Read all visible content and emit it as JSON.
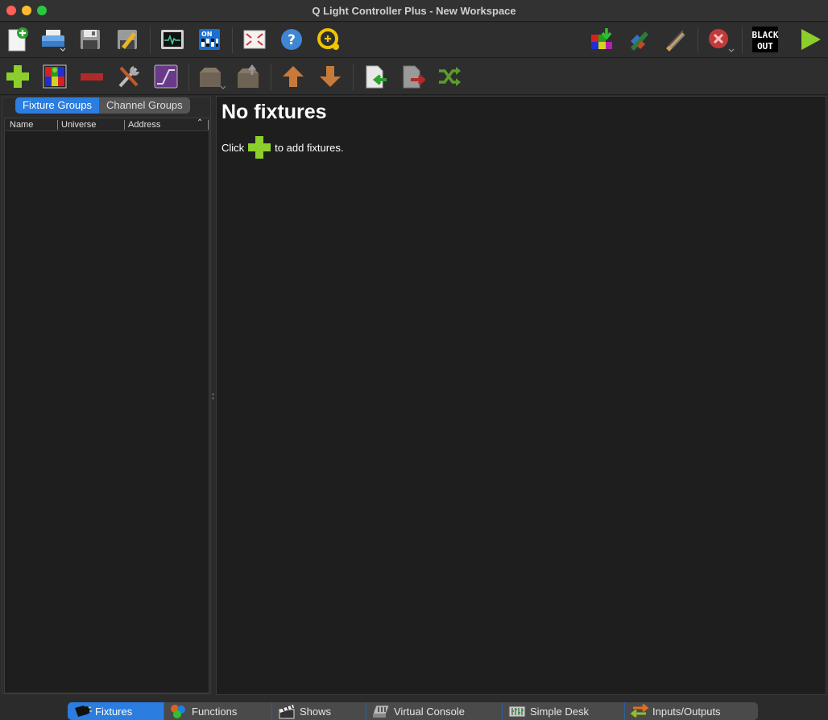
{
  "window": {
    "title": "Q Light Controller Plus - New Workspace"
  },
  "toolbar_main": {
    "items": [
      {
        "name": "new-workspace",
        "icon": "new-document-icon"
      },
      {
        "name": "open-workspace",
        "icon": "printer-open-icon"
      },
      {
        "name": "save-workspace",
        "icon": "floppy-disk-icon"
      },
      {
        "name": "save-as-workspace",
        "icon": "floppy-pencil-icon"
      },
      {
        "name": "monitor",
        "icon": "monitor-waveform-icon"
      },
      {
        "name": "address-tool",
        "icon": "dip-switch-icon",
        "label": "ON"
      },
      {
        "name": "fullscreen",
        "icon": "fullscreen-icon"
      },
      {
        "name": "help",
        "icon": "help-icon",
        "label": "?"
      },
      {
        "name": "about",
        "icon": "qlc-logo-icon"
      },
      {
        "name": "fixture-editor",
        "icon": "fixture-download-icon"
      },
      {
        "name": "design-mode",
        "icon": "design-pencil-icon"
      },
      {
        "name": "operate-mode",
        "icon": "operate-pencil-icon"
      },
      {
        "name": "stop-all",
        "icon": "stop-x-icon"
      },
      {
        "name": "blackout",
        "icon": "blackout-icon",
        "label_top": "BLACK",
        "label_bottom": "OUT"
      },
      {
        "name": "run-mode",
        "icon": "play-icon"
      }
    ]
  },
  "toolbar_fixtures": {
    "items": [
      {
        "name": "add-fixture",
        "icon": "plus-icon"
      },
      {
        "name": "add-rgb-panel",
        "icon": "rgb-panel-icon"
      },
      {
        "name": "remove-fixture",
        "icon": "minus-icon"
      },
      {
        "name": "fixture-properties",
        "icon": "wrench-screwdriver-icon"
      },
      {
        "name": "fade-config",
        "icon": "fade-curve-icon"
      },
      {
        "name": "group-fixtures",
        "icon": "box-icon"
      },
      {
        "name": "remove-from-group",
        "icon": "box-out-icon"
      },
      {
        "name": "move-up",
        "icon": "arrow-up-icon"
      },
      {
        "name": "move-down",
        "icon": "arrow-down-icon"
      },
      {
        "name": "import-fixtures",
        "icon": "import-doc-icon"
      },
      {
        "name": "export-fixtures",
        "icon": "export-doc-icon"
      },
      {
        "name": "remap-fixtures",
        "icon": "shuffle-icon"
      }
    ]
  },
  "left_panel": {
    "tabs": [
      "Fixture Groups",
      "Channel Groups"
    ],
    "active_tab": 0,
    "columns": [
      "Name",
      "Universe",
      "Address"
    ]
  },
  "main": {
    "heading": "No fixtures",
    "hint_before": "Click",
    "hint_after": "to add fixtures."
  },
  "bottom_tabs": [
    {
      "label": "Fixtures",
      "icon": "spotlight-icon",
      "active": true
    },
    {
      "label": "Functions",
      "icon": "functions-icon",
      "active": false
    },
    {
      "label": "Shows",
      "icon": "clapperboard-icon",
      "active": false
    },
    {
      "label": "Virtual Console",
      "icon": "console-icon",
      "active": false
    },
    {
      "label": "Simple Desk",
      "icon": "desk-icon",
      "active": false
    },
    {
      "label": "Inputs/Outputs",
      "icon": "io-arrows-icon",
      "active": false
    }
  ],
  "colors": {
    "accent": "#2b7de0",
    "background": "#2b2b2b",
    "panel": "#1e1e1e",
    "add_green": "#8ccf2c"
  }
}
